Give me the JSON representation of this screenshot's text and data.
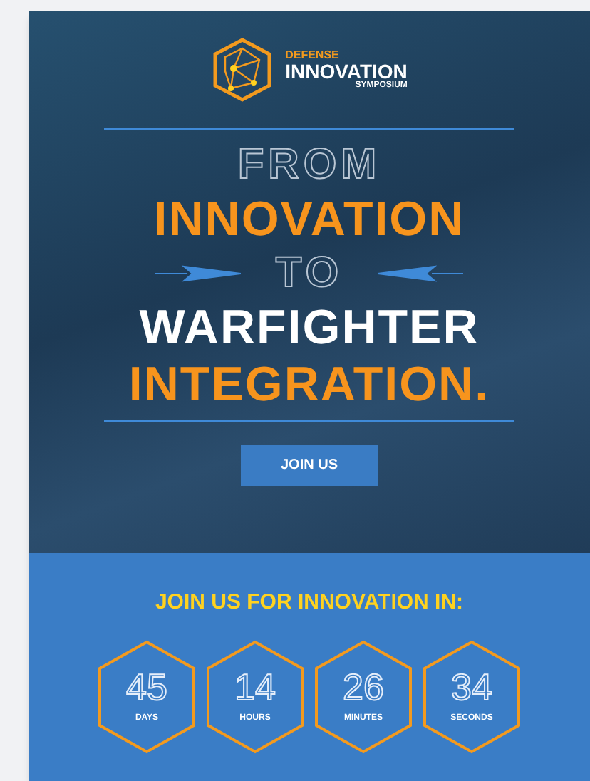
{
  "logo": {
    "top": "DEFENSE",
    "main": "INNOVATION",
    "sub": "SYMPOSIUM"
  },
  "headline": [
    {
      "text": "FROM",
      "kind": "outline"
    },
    {
      "text": "INNOVATION",
      "kind": "orange"
    },
    {
      "text": "TO",
      "kind": "outline-arrows"
    },
    {
      "text": "WARFIGHTER",
      "kind": "white"
    },
    {
      "text": "INTEGRATION.",
      "kind": "orange"
    }
  ],
  "button": "JOIN US",
  "countdown": {
    "title": "JOIN US FOR INNOVATION IN:",
    "units": [
      {
        "value": "45",
        "label": "DAYS"
      },
      {
        "value": "14",
        "label": "HOURS"
      },
      {
        "value": "26",
        "label": "MINUTES"
      },
      {
        "value": "34",
        "label": "SECONDS"
      }
    ]
  }
}
